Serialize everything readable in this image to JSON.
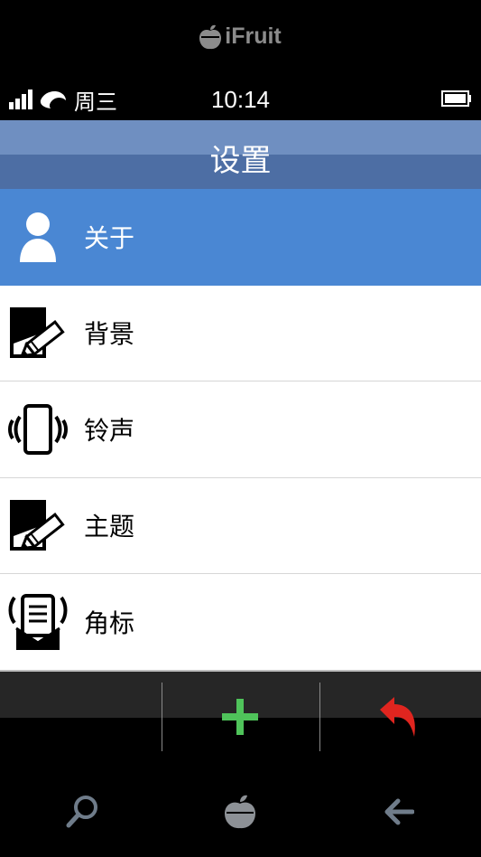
{
  "brand": {
    "name": "iFruit"
  },
  "status": {
    "day": "周三",
    "time": "10:14"
  },
  "header": {
    "title": "设置"
  },
  "menu": {
    "items": [
      {
        "label": "关于",
        "icon": "user-icon",
        "selected": true
      },
      {
        "label": "背景",
        "icon": "edit-screen-icon",
        "selected": false
      },
      {
        "label": "铃声",
        "icon": "vibrate-phone-icon",
        "selected": false
      },
      {
        "label": "主题",
        "icon": "edit-screen-icon",
        "selected": false
      },
      {
        "label": "角标",
        "icon": "notification-icon",
        "selected": false
      }
    ]
  },
  "actions": {
    "add_color": "#4fc35a",
    "back_color": "#e0251f"
  },
  "colors": {
    "selected": "#4a87d3",
    "title_top": "#6f8fc1",
    "title_bottom": "#4d6ea4"
  }
}
